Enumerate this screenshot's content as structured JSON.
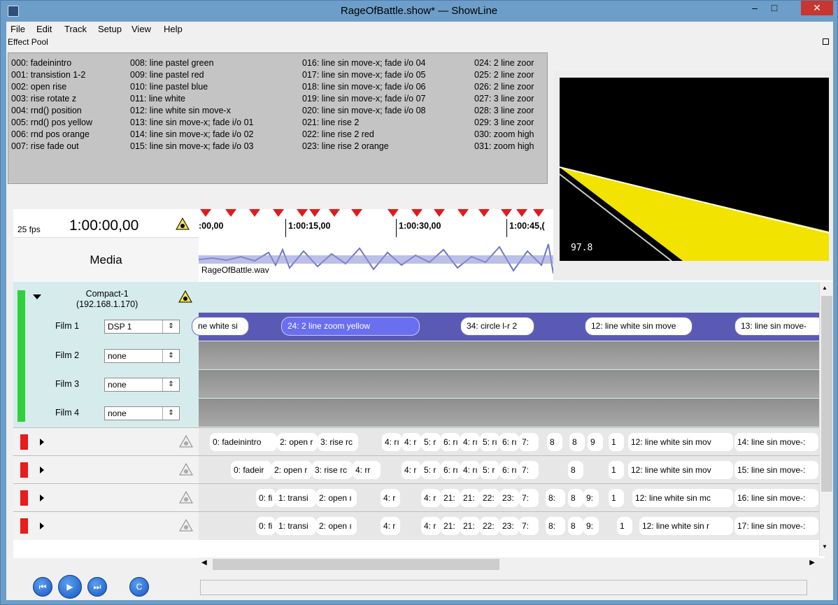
{
  "window": {
    "title": "RageOfBattle.show* — ShowLine",
    "min_label": "–",
    "max_label": "□",
    "close_label": "✕"
  },
  "menu": [
    "File",
    "Edit",
    "Track",
    "Setup",
    "View",
    "Help"
  ],
  "dock_title": "Effect Pool",
  "effect_pool": {
    "col1": [
      "000: fadeinintro",
      "001: transistion 1-2",
      "002: open rise",
      "003: rise rotate z",
      "004: rnd() position",
      "005: rnd() pos yellow",
      "006: rnd pos orange",
      "007: rise fade out"
    ],
    "col2": [
      "008: line pastel green",
      "009: line pastel red",
      "010: line pastel blue",
      "011: line white",
      "012: line white sin move-x",
      "013: line sin move-x; fade i/o 01",
      "014: line sin move-x; fade i/o 02",
      "015: line sin move-x; fade i/o 03"
    ],
    "col3": [
      "016: line sin move-x; fade i/o 04",
      "017: line sin move-x; fade i/o 05",
      "018: line sin move-x; fade i/o 06",
      "019: line sin move-x; fade i/o 07",
      "020: line sin move-x; fade i/o 08",
      "021: line rise 2",
      "022: line rise 2 red",
      "023: line rise 2 orange"
    ],
    "col4": [
      "024: 2 line zoor",
      "025: 2 line zoor",
      "026: 2 line zoor",
      "027: 3 line zoor",
      "028: 3 line zoor",
      "029: 3 line zoor",
      "030: zoom high",
      "031: zoom high"
    ]
  },
  "preview": {
    "value": "97.8"
  },
  "timeline": {
    "fps": "25 fps",
    "timecode": "1:00:00,00",
    "ruler": [
      ":00,00",
      "1:00:15,00",
      "1:00:30,00",
      "1:00:45,("
    ]
  },
  "media": {
    "label": "Media",
    "file": "RageOfBattle.wav"
  },
  "compact": {
    "name": "Compact-1",
    "ip": "(192.168.1.170)",
    "films": [
      {
        "label": "Film 1",
        "value": "DSP 1"
      },
      {
        "label": "Film 2",
        "value": "none"
      },
      {
        "label": "Film 3",
        "value": "none"
      },
      {
        "label": "Film 4",
        "value": "none"
      }
    ],
    "cues": [
      "ne white si",
      "24: 2 line zoom yellow",
      "34: circle l-r 2",
      "12: line white sin move",
      "13: line sin move-"
    ]
  },
  "tracks": [
    {
      "cues": [
        "0: fadeinintro",
        "2: open r",
        "3: rise rc",
        "4: rı",
        "4: r",
        "5: r",
        "6: rı",
        "4: rı",
        "5: rı",
        "6: rı",
        "7:",
        "8",
        "8",
        "9",
        "1",
        "12: line white sin mov",
        "14: line sin move-:"
      ]
    },
    {
      "cues": [
        "0: fadeir",
        "2: open r",
        "3: rise rc",
        "4: rr",
        "4: r",
        "5: r",
        "6: rı",
        "4: rı",
        "5: r",
        "6: rı",
        "7:",
        "8",
        "1",
        "12: line white sin mov",
        "15: line sin move-:"
      ]
    },
    {
      "cues": [
        "0: fi",
        "1: transi",
        "2: open ı",
        "4: r",
        "4: r",
        "21:",
        "21:",
        "22:",
        "23:",
        "7:",
        "8:",
        "8",
        "9:",
        "1",
        "12: line white sin mc",
        "16: line sin move-:"
      ]
    },
    {
      "cues": [
        "0: fi",
        "1: transi",
        "2: open ı",
        "4: r",
        "4: r",
        "21:",
        "21:",
        "22:",
        "23:",
        "7:",
        "8:",
        "8",
        "9:",
        "1",
        "12: line white sin r",
        "17: line sin move-:"
      ]
    }
  ],
  "transport": [
    "⏮",
    "▶",
    "⏭",
    "C"
  ]
}
